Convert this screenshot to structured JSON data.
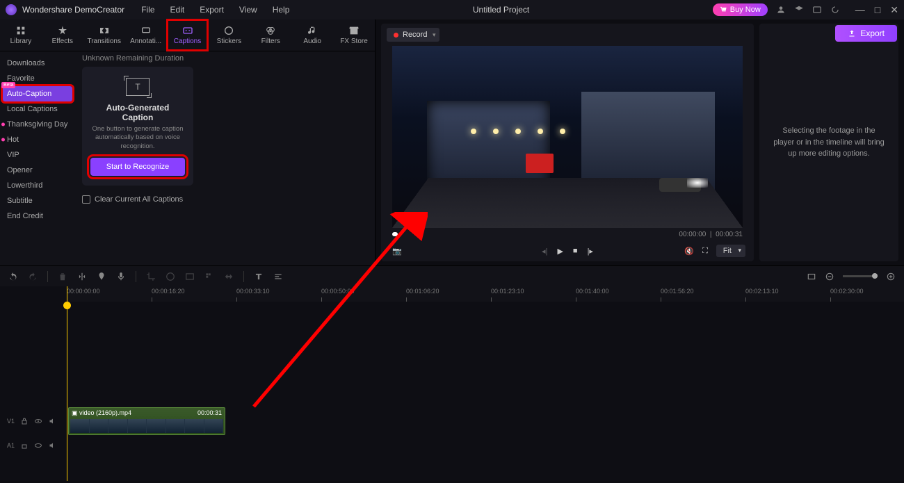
{
  "titlebar": {
    "app_name": "Wondershare DemoCreator",
    "menus": [
      "File",
      "Edit",
      "Export",
      "View",
      "Help"
    ],
    "project_title": "Untitled Project",
    "buy_label": "Buy Now"
  },
  "tool_tabs": [
    {
      "label": "Library",
      "icon": "library-icon"
    },
    {
      "label": "Effects",
      "icon": "effects-icon"
    },
    {
      "label": "Transitions",
      "icon": "transitions-icon"
    },
    {
      "label": "Annotati...",
      "icon": "annotations-icon"
    },
    {
      "label": "Captions",
      "icon": "captions-icon",
      "active": true,
      "highlighted": true
    },
    {
      "label": "Stickers",
      "icon": "stickers-icon"
    },
    {
      "label": "Filters",
      "icon": "filters-icon"
    },
    {
      "label": "Audio",
      "icon": "audio-icon"
    },
    {
      "label": "FX Store",
      "icon": "fxstore-icon"
    }
  ],
  "categories": [
    {
      "label": "Downloads"
    },
    {
      "label": "Favorite"
    },
    {
      "label": "Auto-Caption",
      "active": true,
      "beta": "Beta"
    },
    {
      "label": "Local Captions"
    },
    {
      "label": "Thanksgiving Day",
      "dot": true
    },
    {
      "label": "Hot",
      "dot": true
    },
    {
      "label": "VIP"
    },
    {
      "label": "Opener"
    },
    {
      "label": "Lowerthird"
    },
    {
      "label": "Subtitle"
    },
    {
      "label": "End Credit"
    }
  ],
  "captions_panel": {
    "duration_label": "Unknown Remaining Duration",
    "card_title": "Auto-Generated Caption",
    "card_desc": "One button to generate caption automatically based on voice recognition.",
    "start_button": "Start to Recognize",
    "clear_label": "Clear Current All Captions"
  },
  "preview": {
    "record_label": "Record",
    "time_current": "00:00:00",
    "time_total": "00:00:31",
    "fit_label": "Fit"
  },
  "inspector": {
    "placeholder": "Selecting the footage in the player or in the timeline will bring up more editing options."
  },
  "export_label": "Export",
  "timeline": {
    "ruler_ticks": [
      "00:00:00:00",
      "00:00:16:20",
      "00:00:33:10",
      "00:00:50:00",
      "00:01:06:20",
      "00:01:23:10",
      "00:01:40:00",
      "00:01:56:20",
      "00:02:13:10",
      "00:02:30:00"
    ],
    "clip_name": "video (2160p).mp4",
    "clip_duration": "00:00:31"
  }
}
